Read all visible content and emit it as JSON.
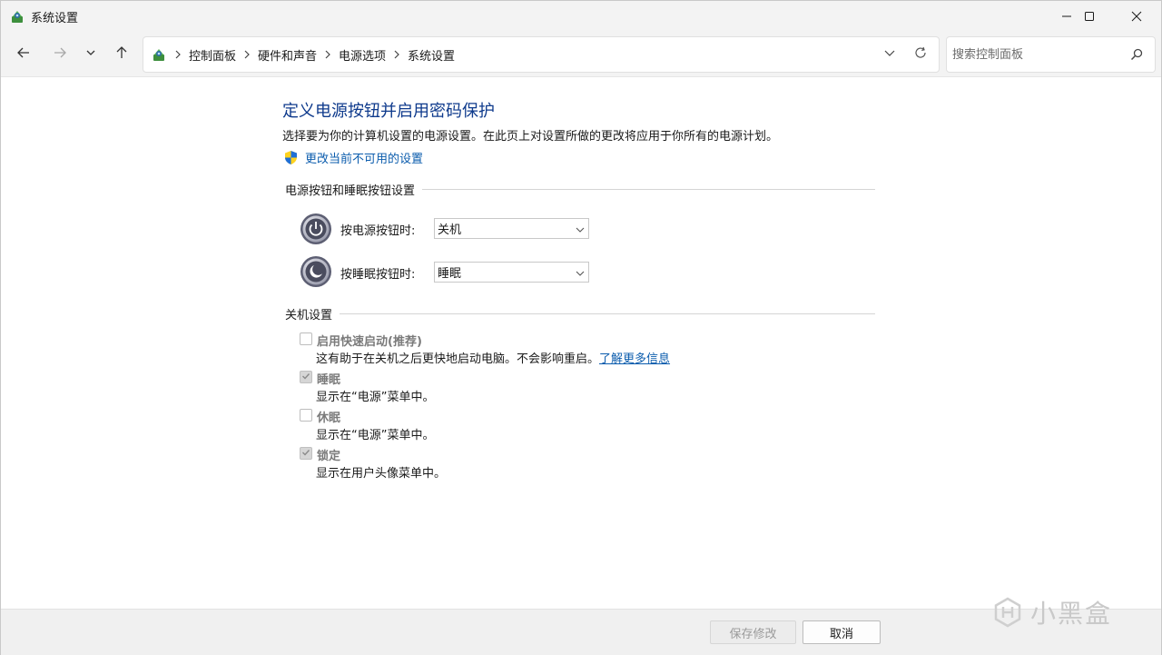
{
  "window": {
    "title": "系统设置",
    "controls": [
      "minimize-icon",
      "maximize-icon",
      "close-icon"
    ]
  },
  "nav": {
    "breadcrumbs": [
      "控制面板",
      "硬件和声音",
      "电源选项",
      "系统设置"
    ],
    "search_placeholder": "搜索控制面板"
  },
  "page": {
    "title": "定义电源按钮并启用密码保护",
    "description": "选择要为你的计算机设置的电源设置。在此页上对设置所做的更改将应用于你所有的电源计划。",
    "change_settings_link": "更改当前不可用的设置"
  },
  "power_section": {
    "header": "电源按钮和睡眠按钮设置",
    "rows": [
      {
        "label": "按电源按钮时:",
        "value": "关机",
        "icon": "power-icon"
      },
      {
        "label": "按睡眠按钮时:",
        "value": "睡眠",
        "icon": "sleep-icon"
      }
    ]
  },
  "shutdown_section": {
    "header": "关机设置",
    "options": [
      {
        "title": "启用快速启动(推荐)",
        "desc": "这有助于在关机之后更快地启动电脑。不会影响重启。",
        "link": "了解更多信息",
        "checked": false
      },
      {
        "title": "睡眠",
        "desc": "显示在“电源”菜单中。",
        "checked": true
      },
      {
        "title": "休眠",
        "desc": "显示在“电源”菜单中。",
        "checked": false
      },
      {
        "title": "锁定",
        "desc": "显示在用户头像菜单中。",
        "checked": true
      }
    ]
  },
  "footer": {
    "save_label": "保存修改",
    "cancel_label": "取消"
  },
  "watermark": "小黑盒",
  "colors": {
    "title_blue": "#0e3a8c",
    "link_blue": "#0b5cad",
    "chrome_bg": "#f3f3f3",
    "footer_bg": "#f0f0f0"
  }
}
